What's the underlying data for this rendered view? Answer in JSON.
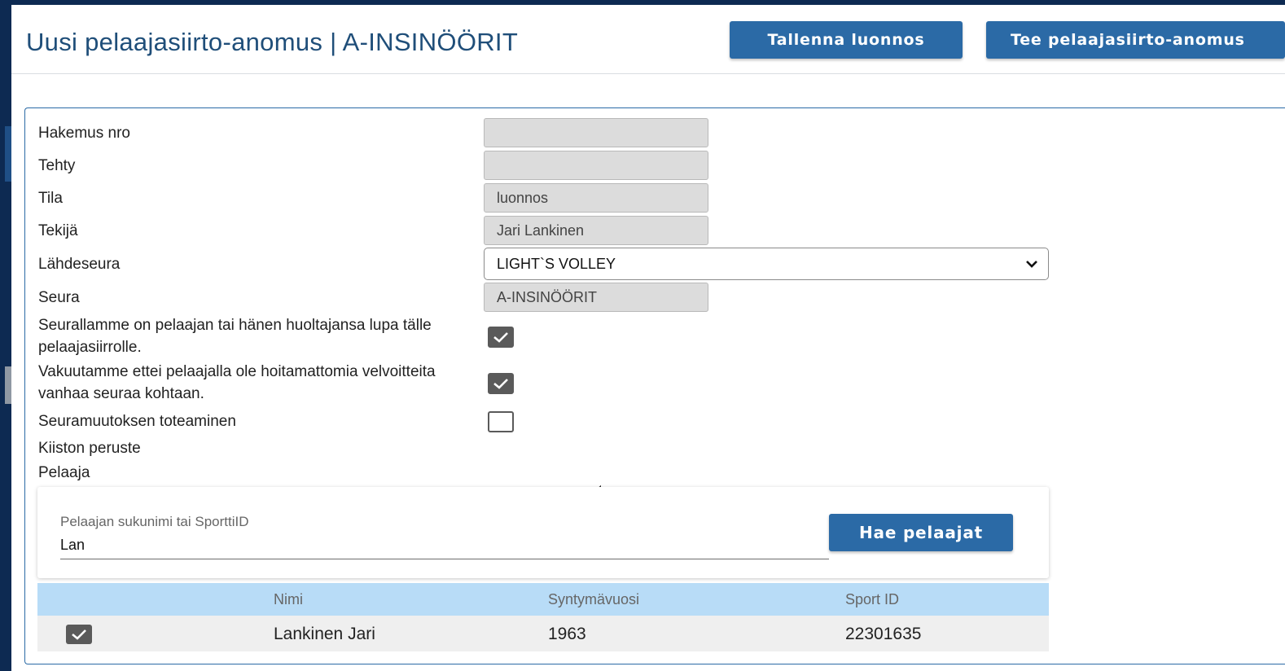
{
  "header": {
    "title": "Uusi pelaajasiirto-anomus | A-INSINÖÖRIT",
    "save_draft_label": "Tallenna luonnos",
    "submit_label": "Tee pelaajasiirto-anomus"
  },
  "form": {
    "application_no": {
      "label": "Hakemus nro",
      "value": ""
    },
    "created": {
      "label": "Tehty",
      "value": ""
    },
    "status": {
      "label": "Tila",
      "value": "luonnos"
    },
    "author": {
      "label": "Tekijä",
      "value": "Jari Lankinen"
    },
    "source_club": {
      "label": "Lähdeseura",
      "value": "LIGHT`S VOLLEY"
    },
    "club": {
      "label": "Seura",
      "value": "A-INSINÖÖRIT"
    },
    "consent": {
      "label": "Seurallamme on pelaajan tai hänen huoltajansa lupa tälle pelaajasiirrolle.",
      "checked": true
    },
    "obligations": {
      "label": "Vakuutamme ettei pelaajalla ole hoitamattomia velvoitteita vanhaa seuraa kohtaan.",
      "checked": true
    },
    "club_change": {
      "label": "Seuramuutoksen toteaminen",
      "checked": false
    },
    "quota_basis": {
      "label": "Kiiston peruste"
    },
    "player": {
      "label": "Pelaaja"
    }
  },
  "player_search": {
    "field_label": "Pelaajan sukunimi tai SporttiID",
    "value": "Lan",
    "button_label": "Hae pelaajat"
  },
  "results": {
    "columns": [
      "Nimi",
      "Syntymävuosi",
      "Sport ID"
    ],
    "rows": [
      {
        "selected": true,
        "name": "Lankinen Jari",
        "birth_year": "1963",
        "sport_id": "22301635"
      }
    ]
  },
  "colors": {
    "primary": "#2b6aa6",
    "title": "#1f4e79",
    "table_header": "#b8dcf7",
    "arrow_fill": "#f5c000"
  },
  "annotation": {
    "icon": "arrow-left-icon",
    "points_to": "Seuramuutoksen toteaminen"
  }
}
